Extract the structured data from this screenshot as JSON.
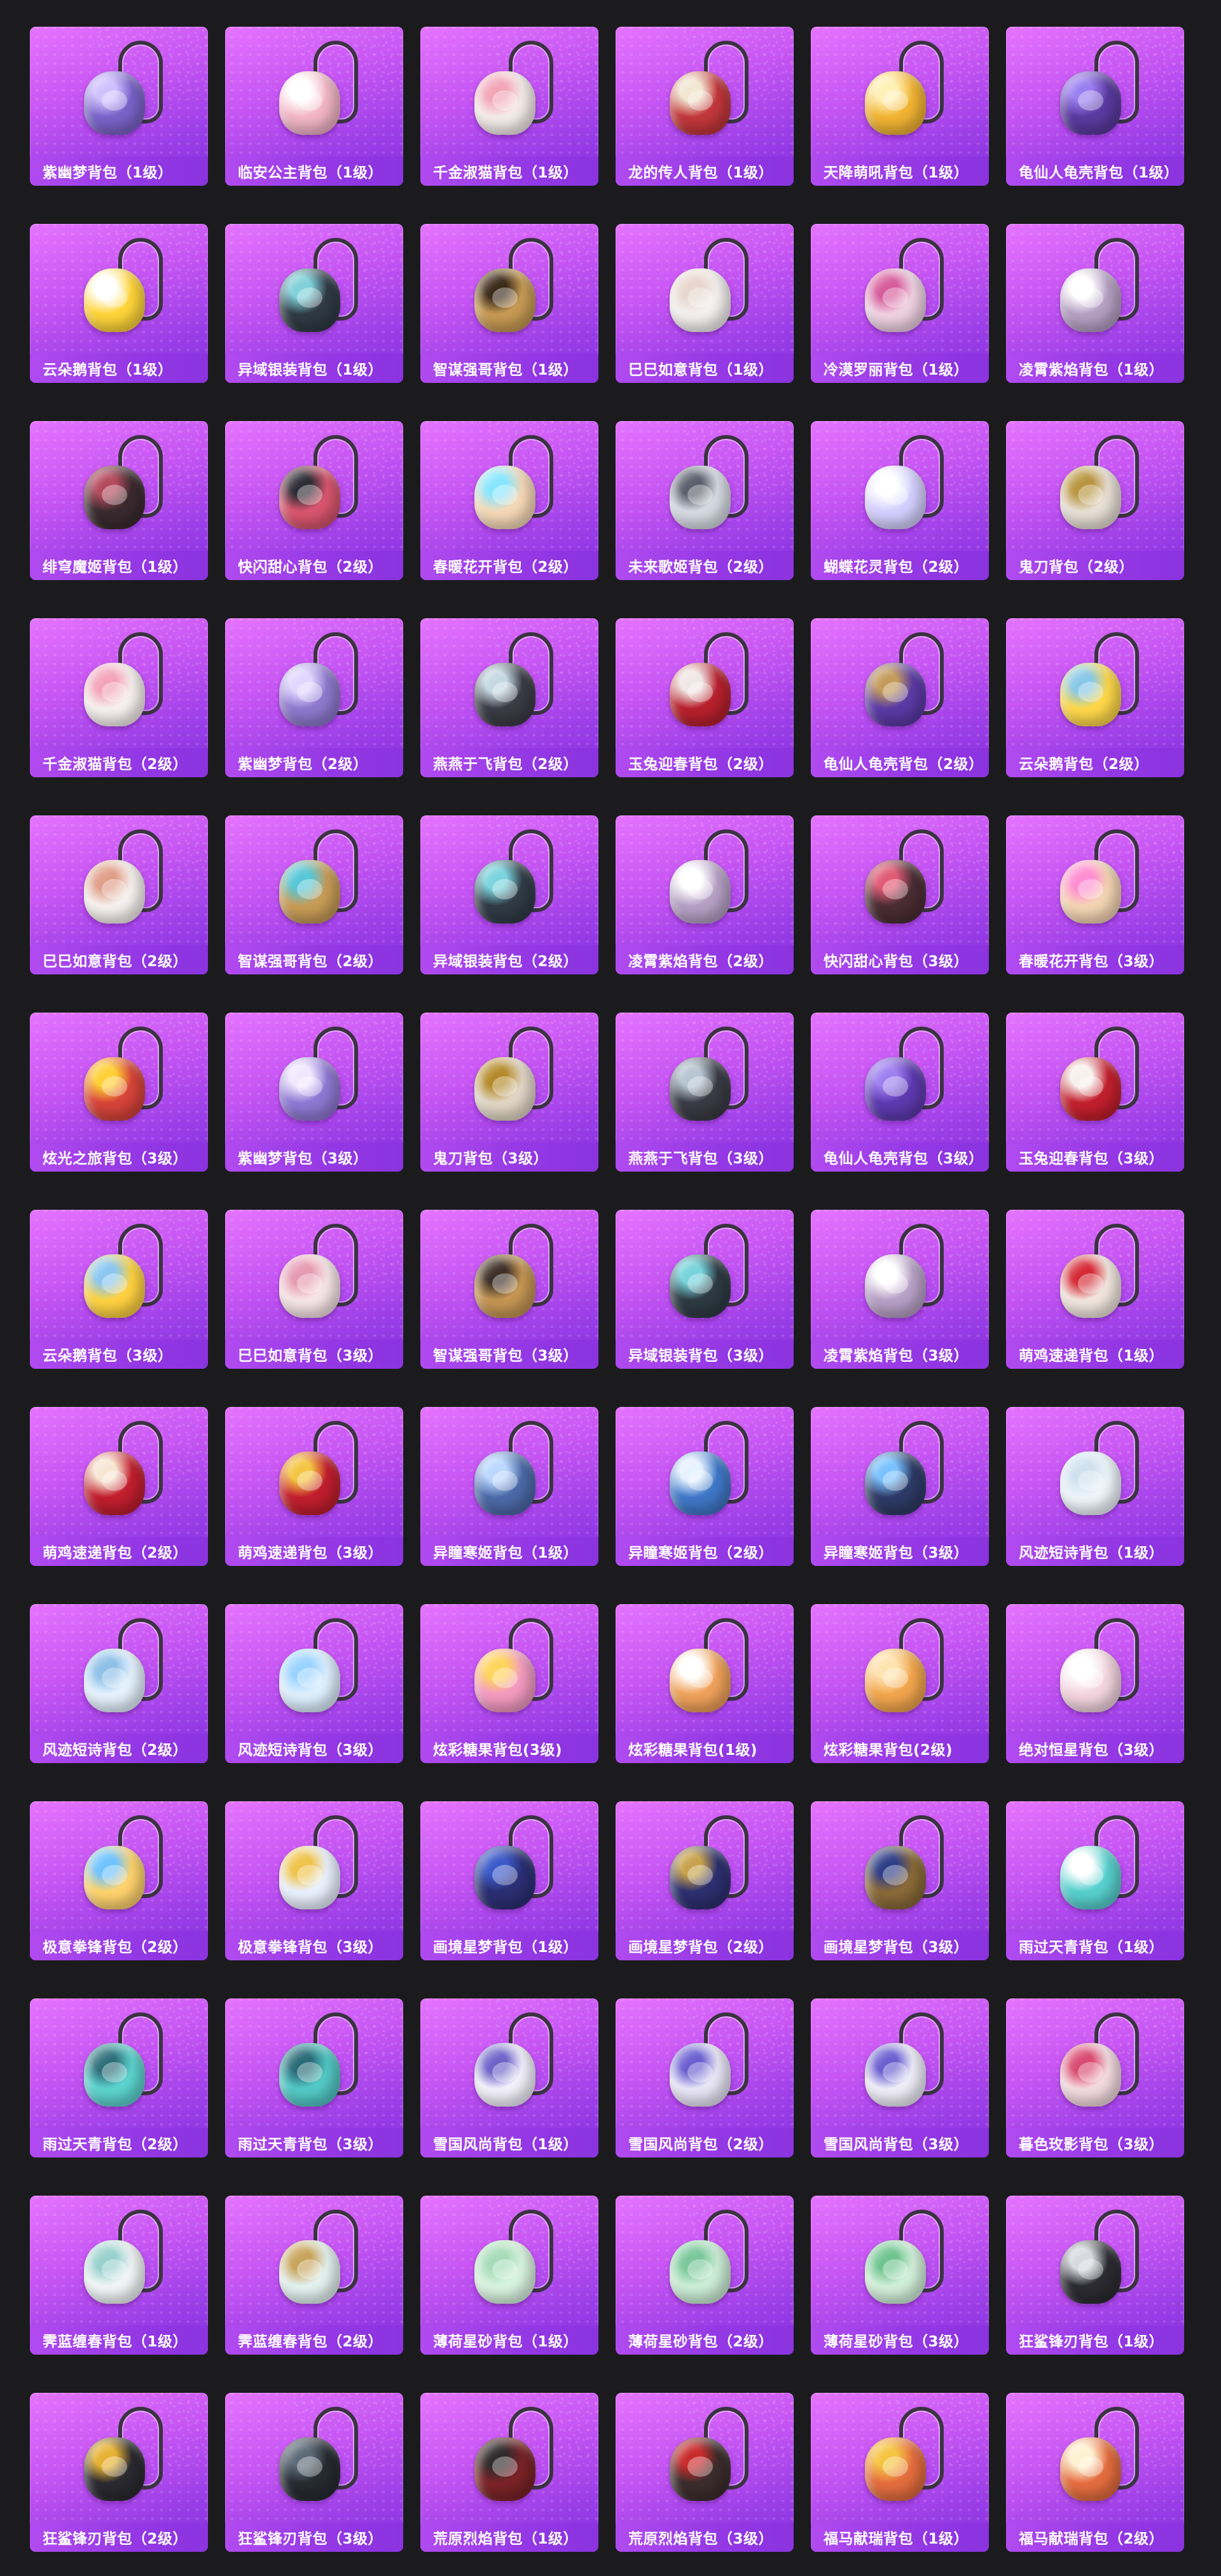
{
  "items": [
    {
      "name": "紫幽梦背包（1级）",
      "color": "#7a63c9",
      "accent": "#cfc0ff"
    },
    {
      "name": "临安公主背包（1级）",
      "color": "#f3b6c8",
      "accent": "#ffffff"
    },
    {
      "name": "千金淑猫背包（1级）",
      "color": "#f5ecea",
      "accent": "#f2a6b8"
    },
    {
      "name": "龙的传人背包（1级）",
      "color": "#c2373b",
      "accent": "#f2e7d2"
    },
    {
      "name": "天降萌吼背包（1级）",
      "color": "#f2b433",
      "accent": "#fff0b5"
    },
    {
      "name": "龟仙人龟壳背包（1级）",
      "color": "#5a3aa0",
      "accent": "#9b7ef0"
    },
    {
      "name": "云朵鹅背包（1级）",
      "color": "#ffd53a",
      "accent": "#ffffff"
    },
    {
      "name": "异域银装背包（1级）",
      "color": "#2f3a44",
      "accent": "#7fd0d8"
    },
    {
      "name": "智谋强哥背包（1级）",
      "color": "#c79b55",
      "accent": "#3b2a1a"
    },
    {
      "name": "巳巳如意背包（1级）",
      "color": "#f4f1ef",
      "accent": "#e7d7ce"
    },
    {
      "name": "冷漠罗丽背包（1级）",
      "color": "#f0d2e4",
      "accent": "#d65c9b"
    },
    {
      "name": "凌霄紫焰背包（1级）",
      "color": "#b6a0c4",
      "accent": "#ffffff"
    },
    {
      "name": "绯穹魔姬背包（1级）",
      "color": "#3a2a2f",
      "accent": "#b24a5c"
    },
    {
      "name": "快闪甜心背包（2级）",
      "color": "#d9566f",
      "accent": "#2d2d35"
    },
    {
      "name": "春暖花开背包（2级）",
      "color": "#f6d9b8",
      "accent": "#88e6ff"
    },
    {
      "name": "未来歌姬背包（2级）",
      "color": "#d7dbe4",
      "accent": "#5b5f6b"
    },
    {
      "name": "蝴蝶花灵背包（2级）",
      "color": "#d5d0ff",
      "accent": "#ffffff"
    },
    {
      "name": "鬼刀背包（2级）",
      "color": "#e9e0d6",
      "accent": "#b8953f"
    },
    {
      "name": "千金淑猫背包（2级）",
      "color": "#f7f1ef",
      "accent": "#f3a3bb"
    },
    {
      "name": "紫幽梦背包（2级）",
      "color": "#8f79cf",
      "accent": "#e0d7ff"
    },
    {
      "name": "燕燕于飞背包（2级）",
      "color": "#3b3b46",
      "accent": "#c6d9e3"
    },
    {
      "name": "玉兔迎春背包（2级）",
      "color": "#b8202d",
      "accent": "#f0e8e6"
    },
    {
      "name": "龟仙人龟壳背包（2级）",
      "color": "#5a3aa6",
      "accent": "#c39b5a"
    },
    {
      "name": "云朵鹅背包（2级）",
      "color": "#ffd84a",
      "accent": "#89c8e8"
    },
    {
      "name": "巳巳如意背包（2级）",
      "color": "#f7f2ef",
      "accent": "#e09f89"
    },
    {
      "name": "智谋强哥背包（2级）",
      "color": "#c89c58",
      "accent": "#58c7d7"
    },
    {
      "name": "异域银装背包（2级）",
      "color": "#303b46",
      "accent": "#7ad4de"
    },
    {
      "name": "凌霄紫焰背包（2级）",
      "color": "#b7a1c6",
      "accent": "#ffffff"
    },
    {
      "name": "快闪甜心背包（3级）",
      "color": "#4a2d34",
      "accent": "#e05a75"
    },
    {
      "name": "春暖花开背包（3级）",
      "color": "#f5d5b4",
      "accent": "#ff8dd2"
    },
    {
      "name": "炫光之旅背包（3级）",
      "color": "#d7443a",
      "accent": "#ffcf33"
    },
    {
      "name": "紫幽梦背包（3级）",
      "color": "#8f79d4",
      "accent": "#f1e8ff"
    },
    {
      "name": "鬼刀背包（3级）",
      "color": "#e2d7c7",
      "accent": "#b48a2b"
    },
    {
      "name": "燕燕于飞背包（3级）",
      "color": "#3a3a45",
      "accent": "#b6c5d1"
    },
    {
      "name": "龟仙人龟壳背包（3级）",
      "color": "#5e3ab0",
      "accent": "#9e7ff0"
    },
    {
      "name": "玉兔迎春背包（3级）",
      "color": "#c31f2d",
      "accent": "#f7f1ee"
    },
    {
      "name": "云朵鹅背包（3级）",
      "color": "#ffd241",
      "accent": "#8bc7f0"
    },
    {
      "name": "巳巳如意背包（3级）",
      "color": "#f7e5e7",
      "accent": "#e69ab3"
    },
    {
      "name": "智谋强哥背包（3级）",
      "color": "#c59654",
      "accent": "#3e3028"
    },
    {
      "name": "异域银装背包（3级）",
      "color": "#2d3a43",
      "accent": "#76d3dc"
    },
    {
      "name": "凌霄紫焰背包（3级）",
      "color": "#b8a1c7",
      "accent": "#ffffff"
    },
    {
      "name": "萌鸡速递背包（1级）",
      "color": "#f2e6df",
      "accent": "#d52a35"
    },
    {
      "name": "萌鸡速递背包（2级）",
      "color": "#c21e2e",
      "accent": "#f8e6d3"
    },
    {
      "name": "萌鸡速递背包（3级）",
      "color": "#c21e2e",
      "accent": "#f5c542"
    },
    {
      "name": "异瞳寒姬背包（1级）",
      "color": "#4c6aa8",
      "accent": "#bcd8ff"
    },
    {
      "name": "异瞳寒姬背包（2级）",
      "color": "#3f78c8",
      "accent": "#e7f2ff"
    },
    {
      "name": "异瞳寒姬背包（3级）",
      "color": "#2e3a66",
      "accent": "#79c2ff"
    },
    {
      "name": "风迹短诗背包（1级）",
      "color": "#eef5fb",
      "accent": "#cfe1ef"
    },
    {
      "name": "风迹短诗背包（2级）",
      "color": "#e6f3ff",
      "accent": "#8fc0e8"
    },
    {
      "name": "风迹短诗背包（3级）",
      "color": "#dff0ff",
      "accent": "#9ad3ff"
    },
    {
      "name": "炫彩糖果背包(3级)",
      "color": "#f49bc2",
      "accent": "#ffd45a"
    },
    {
      "name": "炫彩糖果背包(1级)",
      "color": "#f0a25a",
      "accent": "#ffffff"
    },
    {
      "name": "炫彩糖果背包(2级)",
      "color": "#f2a64d",
      "accent": "#ffe3b0"
    },
    {
      "name": "绝对恒星背包（3级）",
      "color": "#f4d5df",
      "accent": "#ffffff"
    },
    {
      "name": "极意拳锋背包（2级）",
      "color": "#ffd46e",
      "accent": "#6ec3ff"
    },
    {
      "name": "极意拳锋背包（3级）",
      "color": "#eaf2ff",
      "accent": "#f0c34a"
    },
    {
      "name": "画境星梦背包（1级）",
      "color": "#2b2f74",
      "accent": "#3b5ac9"
    },
    {
      "name": "画境星梦背包（2级）",
      "color": "#2d2f70",
      "accent": "#c7a24b"
    },
    {
      "name": "画境星梦背包（3级）",
      "color": "#8a6a39",
      "accent": "#2f3e88"
    },
    {
      "name": "雨过天青背包（1级）",
      "color": "#58d1cf",
      "accent": "#ffffff"
    },
    {
      "name": "雨过天青背包（2级）",
      "color": "#5dd4cf",
      "accent": "#2f6f7a"
    },
    {
      "name": "雨过天青背包（3级）",
      "color": "#53c9c6",
      "accent": "#2a6b78"
    },
    {
      "name": "雪国风尚背包（1级）",
      "color": "#f3f1fb",
      "accent": "#6f63c8"
    },
    {
      "name": "雪国风尚背包（2级）",
      "color": "#e9e6f7",
      "accent": "#6b5fd0"
    },
    {
      "name": "雪国风尚背包（3级）",
      "color": "#f0eef9",
      "accent": "#6b5fd0"
    },
    {
      "name": "暮色玫影背包（3级）",
      "color": "#f4dbe1",
      "accent": "#d94a70"
    },
    {
      "name": "霁蓝缠春背包（1级）",
      "color": "#f2f6f7",
      "accent": "#98d0cc"
    },
    {
      "name": "霁蓝缠春背包（2级）",
      "color": "#e4f2f0",
      "accent": "#c8a45b"
    },
    {
      "name": "薄荷星砂背包（1级）",
      "color": "#d9f4e0",
      "accent": "#a6dcb8"
    },
    {
      "name": "薄荷星砂背包（2级）",
      "color": "#cdeed7",
      "accent": "#7ac79a"
    },
    {
      "name": "薄荷星砂背包（3级）",
      "color": "#d2f0da",
      "accent": "#6fc48f"
    },
    {
      "name": "狂鲨锋刃背包（1级）",
      "color": "#2b2b31",
      "accent": "#d7dbe0"
    },
    {
      "name": "狂鲨锋刃背包（2级）",
      "color": "#2a2930",
      "accent": "#e7b233"
    },
    {
      "name": "狂鲨锋刃背包（3级）",
      "color": "#262a31",
      "accent": "#5c6b77"
    },
    {
      "name": "荒原烈焰背包（1级）",
      "color": "#7a2327",
      "accent": "#2f2a2b"
    },
    {
      "name": "荒原烈焰背包（3级）",
      "color": "#3b2c2d",
      "accent": "#c92a2a"
    },
    {
      "name": "福马献瑞背包（1级）",
      "color": "#e56d3f",
      "accent": "#f5c542"
    },
    {
      "name": "福马献瑞背包（2级）",
      "color": "#e56d3f",
      "accent": "#fff2d2"
    }
  ]
}
